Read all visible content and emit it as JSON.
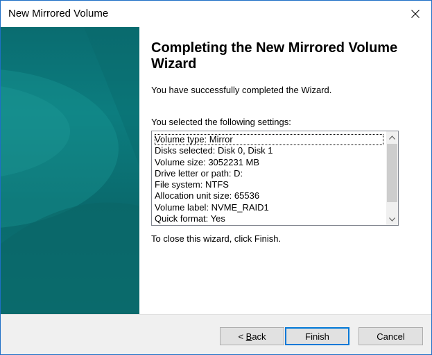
{
  "window": {
    "title": "New Mirrored Volume"
  },
  "heading": "Completing the New Mirrored Volume Wizard",
  "success_text": "You have successfully completed the Wizard.",
  "settings_label": "You selected the following settings:",
  "settings": [
    "Volume type: Mirror",
    "Disks selected: Disk 0, Disk 1",
    "Volume size: 3052231 MB",
    "Drive letter or path: D:",
    "File system: NTFS",
    "Allocation unit size: 65536",
    "Volume label: NVME_RAID1",
    "Quick format: Yes"
  ],
  "close_hint": "To close this wizard, click Finish.",
  "buttons": {
    "back_mnemonic": "B",
    "back_rest": "ack",
    "back_prefix": "< ",
    "finish": "Finish",
    "cancel": "Cancel"
  },
  "colors": {
    "banner": "#0c7d7f",
    "window_border": "#1e6fc6",
    "default_button_border": "#0078d7",
    "footer": "#f0f0f0"
  },
  "icons": {
    "close": "close-icon",
    "scroll_up": "chevron-up-icon",
    "scroll_down": "chevron-down-icon"
  }
}
